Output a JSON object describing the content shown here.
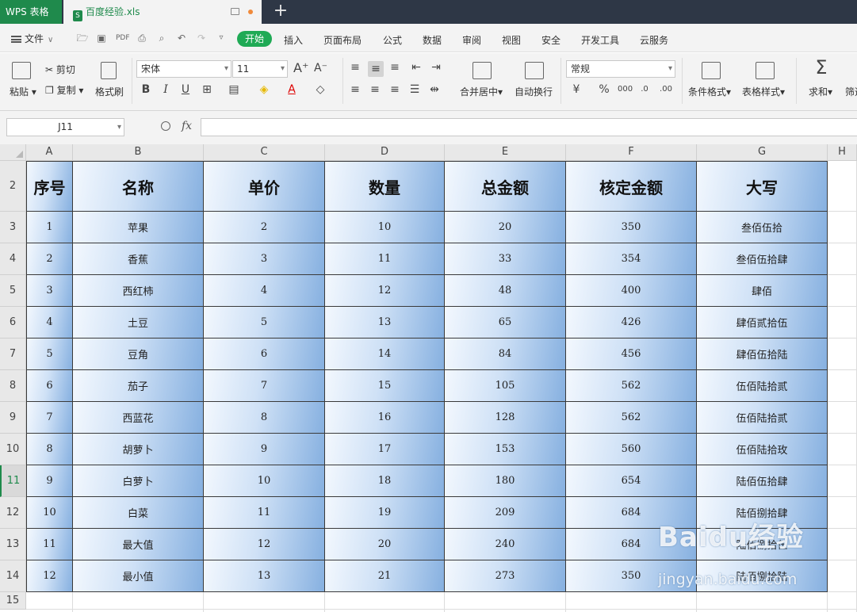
{
  "titlebar": {
    "app_tab": "WPS 表格",
    "doc_tab": "百度经验.xls",
    "new_tab_symbol": "+"
  },
  "menu": {
    "file": "文件",
    "tabs": [
      "开始",
      "插入",
      "页面布局",
      "公式",
      "数据",
      "审阅",
      "视图",
      "安全",
      "开发工具",
      "云服务"
    ]
  },
  "ribbon": {
    "paste": "粘贴",
    "cut": "剪切",
    "copy": "复制",
    "format_painter": "格式刷",
    "font_name": "宋体",
    "font_size": "11",
    "merge_center": "合并居中",
    "wrap_text": "自动换行",
    "number_format": "常规",
    "conditional_format": "条件格式",
    "table_style": "表格样式",
    "sum": "求和",
    "filter": "筛选"
  },
  "formula_bar": {
    "name_box": "J11",
    "fx": "fx",
    "formula": ""
  },
  "sheet": {
    "columns": [
      "A",
      "B",
      "C",
      "D",
      "E",
      "F",
      "G",
      "H"
    ],
    "row_numbers": [
      "2",
      "3",
      "4",
      "5",
      "6",
      "7",
      "8",
      "9",
      "10",
      "11",
      "12",
      "13",
      "14",
      "15"
    ],
    "selected_row": "11",
    "header": [
      "序号",
      "名称",
      "单价",
      "数量",
      "总金额",
      "核定金额",
      "大写"
    ],
    "rows": [
      [
        "1",
        "苹果",
        "2",
        "10",
        "20",
        "350",
        "叁佰伍拾"
      ],
      [
        "2",
        "香蕉",
        "3",
        "11",
        "33",
        "354",
        "叁佰伍拾肆"
      ],
      [
        "3",
        "西红柿",
        "4",
        "12",
        "48",
        "400",
        "肆佰"
      ],
      [
        "4",
        "土豆",
        "5",
        "13",
        "65",
        "426",
        "肆佰贰拾伍"
      ],
      [
        "5",
        "豆角",
        "6",
        "14",
        "84",
        "456",
        "肆佰伍拾陆"
      ],
      [
        "6",
        "茄子",
        "7",
        "15",
        "105",
        "562",
        "伍佰陆拾贰"
      ],
      [
        "7",
        "西蓝花",
        "8",
        "16",
        "128",
        "562",
        "伍佰陆拾贰"
      ],
      [
        "8",
        "胡萝卜",
        "9",
        "17",
        "153",
        "560",
        "伍佰陆拾玫"
      ],
      [
        "9",
        "白萝卜",
        "10",
        "18",
        "180",
        "654",
        "陆佰伍拾肆"
      ],
      [
        "10",
        "白菜",
        "11",
        "19",
        "209",
        "684",
        "陆佰捌拾肆"
      ],
      [
        "11",
        "最大值",
        "12",
        "20",
        "240",
        "684",
        "陆佰捌拾伍"
      ],
      [
        "12",
        "最小值",
        "13",
        "21",
        "273",
        "350",
        "陆佰捌拾陆"
      ]
    ]
  },
  "watermark": {
    "logo": "Baidu经验",
    "url": "jingyan.baidu.com"
  }
}
